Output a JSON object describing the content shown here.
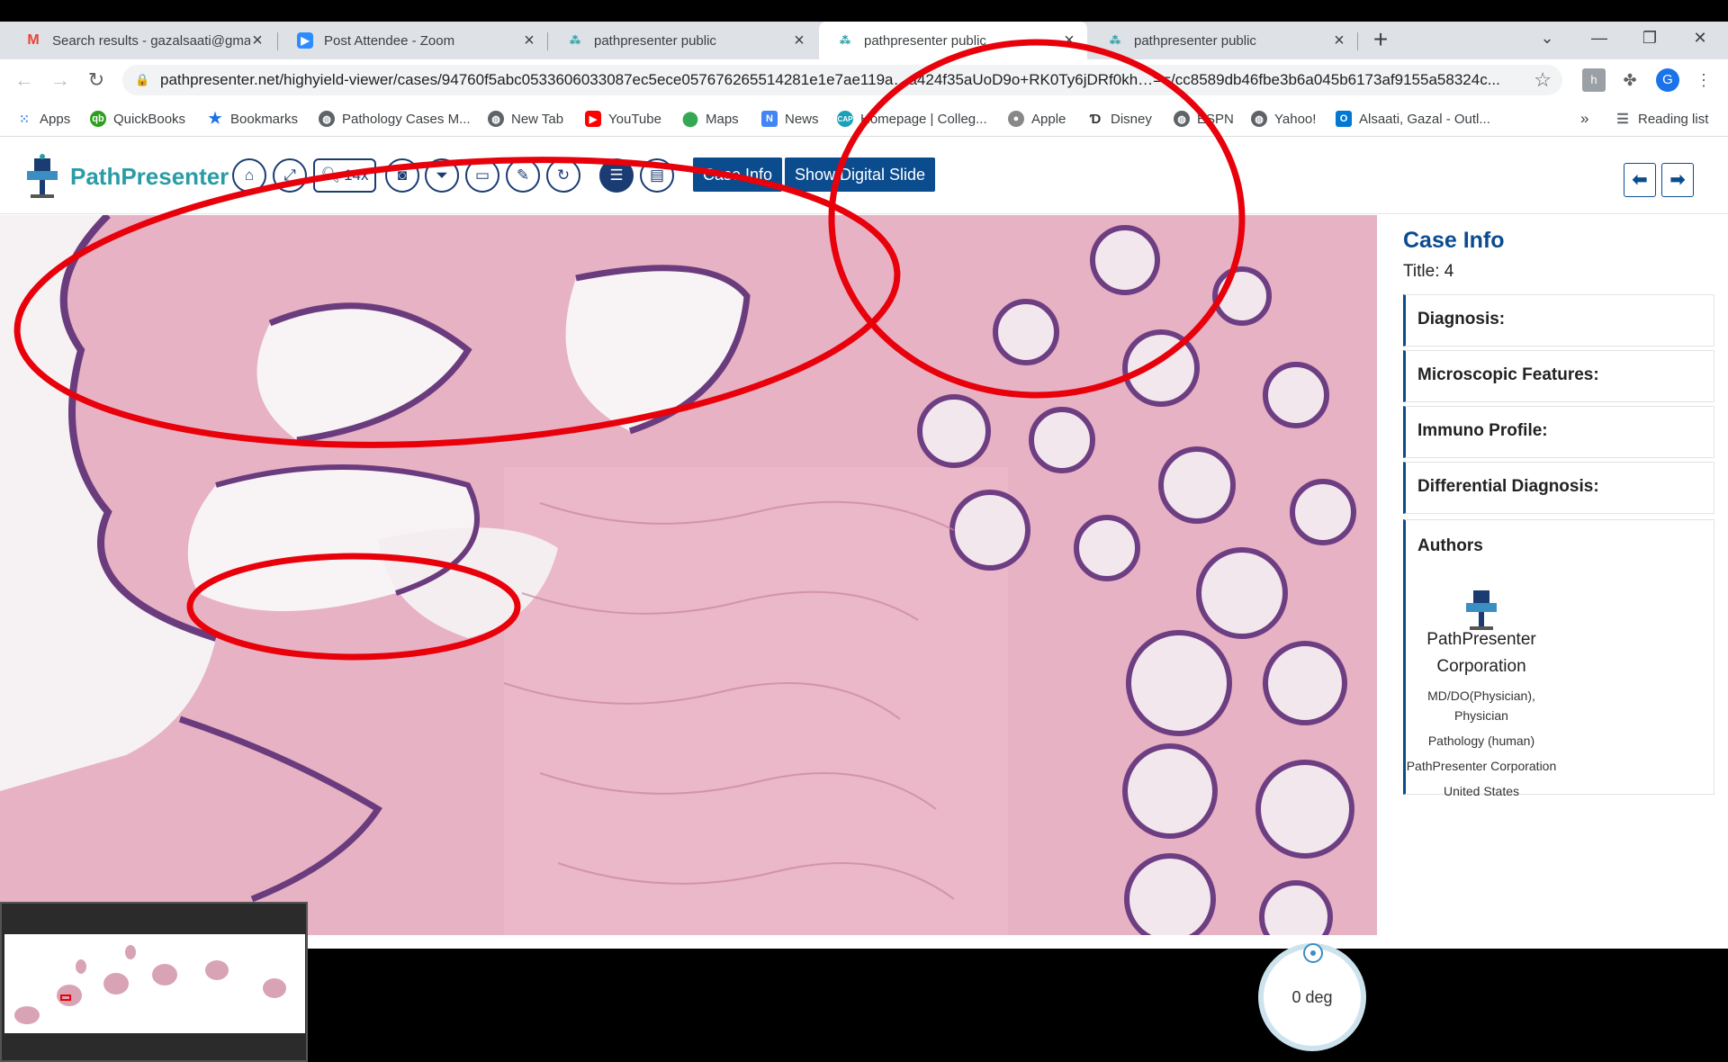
{
  "browser": {
    "tabs": [
      {
        "title": "Search results - gazalsaati@gma",
        "icon": "gmail-icon"
      },
      {
        "title": "Post Attendee - Zoom",
        "icon": "zoom-icon"
      },
      {
        "title": "pathpresenter public",
        "icon": "pathpresenter-icon"
      },
      {
        "title": "pathpresenter public",
        "icon": "pathpresenter-icon"
      },
      {
        "title": "pathpresenter public",
        "icon": "pathpresenter-icon"
      }
    ],
    "active_tab": 3,
    "url": "pathpresenter.net/highyield-viewer/cases/94760f5abc0533606033087ec5ece057676265514281e1e7ae119a…a424f35aUoD9o+RK0Ty6jDRf0kh…==/cc8589db46fbe3b6a045b6173af9155a58324c...",
    "profile_initial": "G",
    "bookmarks": [
      "Apps",
      "QuickBooks",
      "Bookmarks",
      "Pathology Cases M...",
      "New Tab",
      "YouTube",
      "Maps",
      "News",
      "Homepage | Colleg...",
      "Apple",
      "Disney",
      "ESPN",
      "Yahoo!",
      "Alsaati, Gazal - Outl..."
    ],
    "overflow_label": "»",
    "reading_list": "Reading list"
  },
  "app": {
    "brand": "PathPresenter",
    "zoom_level": "14x",
    "case_info_button": "Case Info",
    "show_slide_button": "Show Digital Slide",
    "rotation": "0 deg"
  },
  "panel": {
    "title": "Case Info",
    "case_title": "Title: 4",
    "sections": [
      "Diagnosis:",
      "Microscopic Features:",
      "Immuno Profile:",
      "Differential Diagnosis:"
    ],
    "authors_label": "Authors",
    "author": {
      "name": "PathPresenter Corporation",
      "degree": "MD/DO(Physician), Physician",
      "specialty": "Pathology (human)",
      "org": "PathPresenter Corporation",
      "country": "United States"
    }
  },
  "colors": {
    "accent": "#0b4c8f",
    "brand_teal": "#2a9ca5",
    "annotation": "#e8000b",
    "tissue_pink": "#e8b9c9"
  }
}
